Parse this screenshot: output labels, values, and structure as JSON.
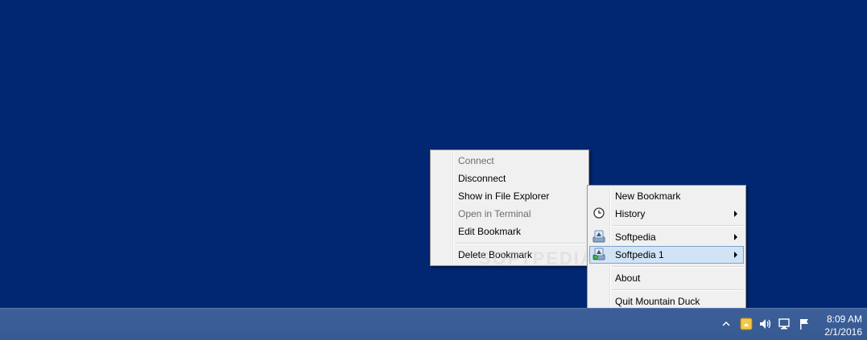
{
  "bookmark_menu": {
    "items": [
      {
        "label": "Connect",
        "disabled": true
      },
      {
        "label": "Disconnect",
        "disabled": false
      },
      {
        "label": "Show in File Explorer",
        "disabled": false
      },
      {
        "label": "Open in Terminal",
        "disabled": true
      },
      {
        "label": "Edit Bookmark",
        "disabled": false
      },
      {
        "label": "Delete Bookmark",
        "disabled": false
      }
    ]
  },
  "tray_menu": {
    "new_bookmark": "New Bookmark",
    "history": "History",
    "bookmark_1": "Softpedia",
    "bookmark_2": "Softpedia 1",
    "about": "About",
    "quit": "Quit Mountain Duck"
  },
  "taskbar": {
    "time": "8:09 AM",
    "date": "2/1/2016"
  },
  "watermark": "SOFTPEDIA",
  "icons": {
    "history": "clock-icon",
    "bookmark": "drive-icon",
    "bookmark_connected": "drive-connected-icon",
    "tray": [
      "show-hidden-icons-icon",
      "mountain-duck-icon",
      "volume-icon",
      "network-icon",
      "action-center-flag-icon"
    ]
  },
  "colors": {
    "desktop": "#012772",
    "taskbar": "#3a5c96",
    "menu_bg": "#f0f0f0",
    "highlight": "#d1e4f6",
    "highlight_border": "#7da2ce",
    "disabled_text": "#6d6d6d"
  }
}
